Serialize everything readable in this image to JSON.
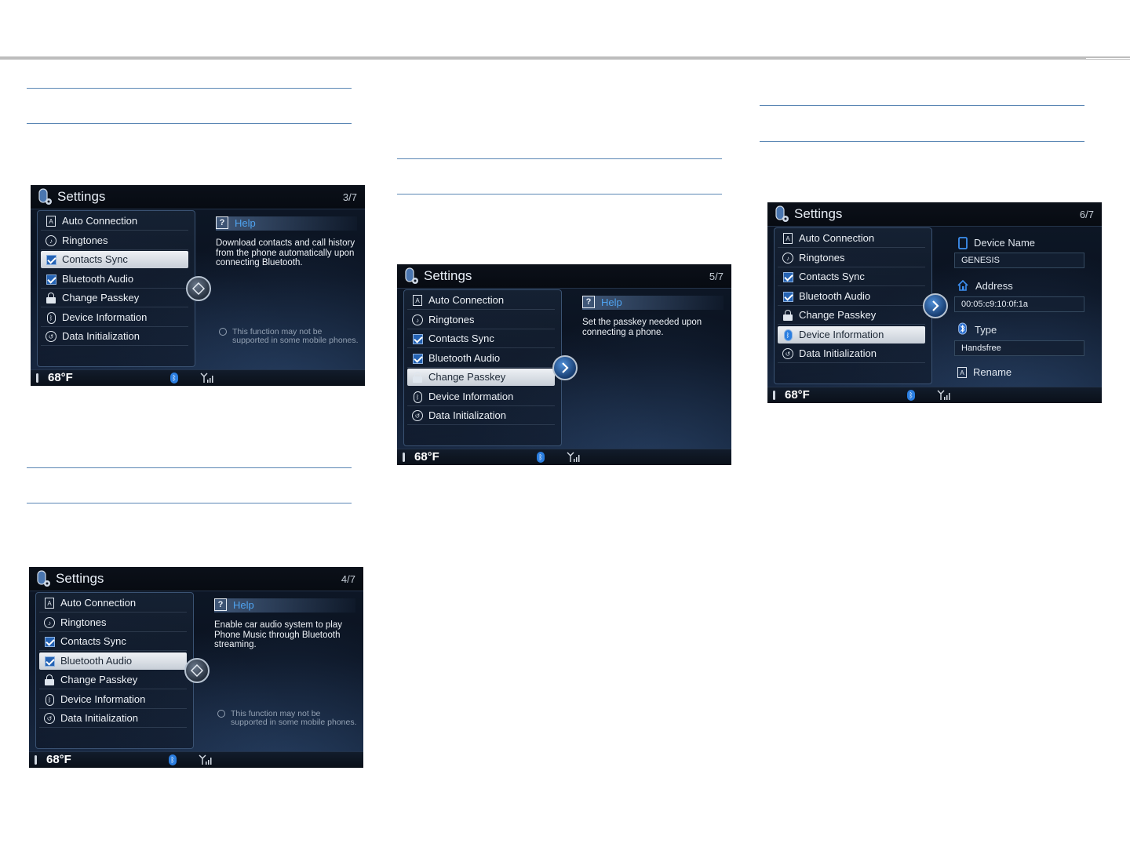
{
  "screens": [
    {
      "title": "Settings",
      "page": "3/7",
      "menu": [
        "Auto Connection",
        "Ringtones",
        "Contacts Sync",
        "Bluetooth Audio",
        "Change Passkey",
        "Device Information",
        "Data Initialization"
      ],
      "help_title": "Help",
      "help_text": "Download contacts and call history from the phone automatically upon connecting Bluetooth.",
      "note": "This function may not be supported in some mobile phones.",
      "temperature": "68°F"
    },
    {
      "title": "Settings",
      "page": "4/7",
      "menu": [
        "Auto Connection",
        "Ringtones",
        "Contacts Sync",
        "Bluetooth Audio",
        "Change Passkey",
        "Device Information",
        "Data Initialization"
      ],
      "help_title": "Help",
      "help_text": "Enable car audio system to play Phone Music through Bluetooth streaming.",
      "note": "This function may not be supported in some mobile phones.",
      "temperature": "68°F"
    },
    {
      "title": "Settings",
      "page": "5/7",
      "menu": [
        "Auto Connection",
        "Ringtones",
        "Contacts Sync",
        "Bluetooth Audio",
        "Change Passkey",
        "Device Information",
        "Data Initialization"
      ],
      "help_title": "Help",
      "help_text": "Set the passkey needed upon connecting a phone.",
      "temperature": "68°F"
    },
    {
      "title": "Settings",
      "page": "6/7",
      "menu": [
        "Auto Connection",
        "Ringtones",
        "Contacts Sync",
        "Bluetooth Audio",
        "Change Passkey",
        "Device Information",
        "Data Initialization"
      ],
      "device_name_label": "Device Name",
      "device_name": "GENESIS",
      "address_label": "Address",
      "address": "00:05:c9:10:0f:1a",
      "type_label": "Type",
      "type": "Handsfree",
      "rename_label": "Rename",
      "temperature": "68°F"
    }
  ],
  "colors": {
    "rule": "#5a86b4",
    "accent": "#4fa3f0",
    "checkbox": "#2563b4"
  }
}
